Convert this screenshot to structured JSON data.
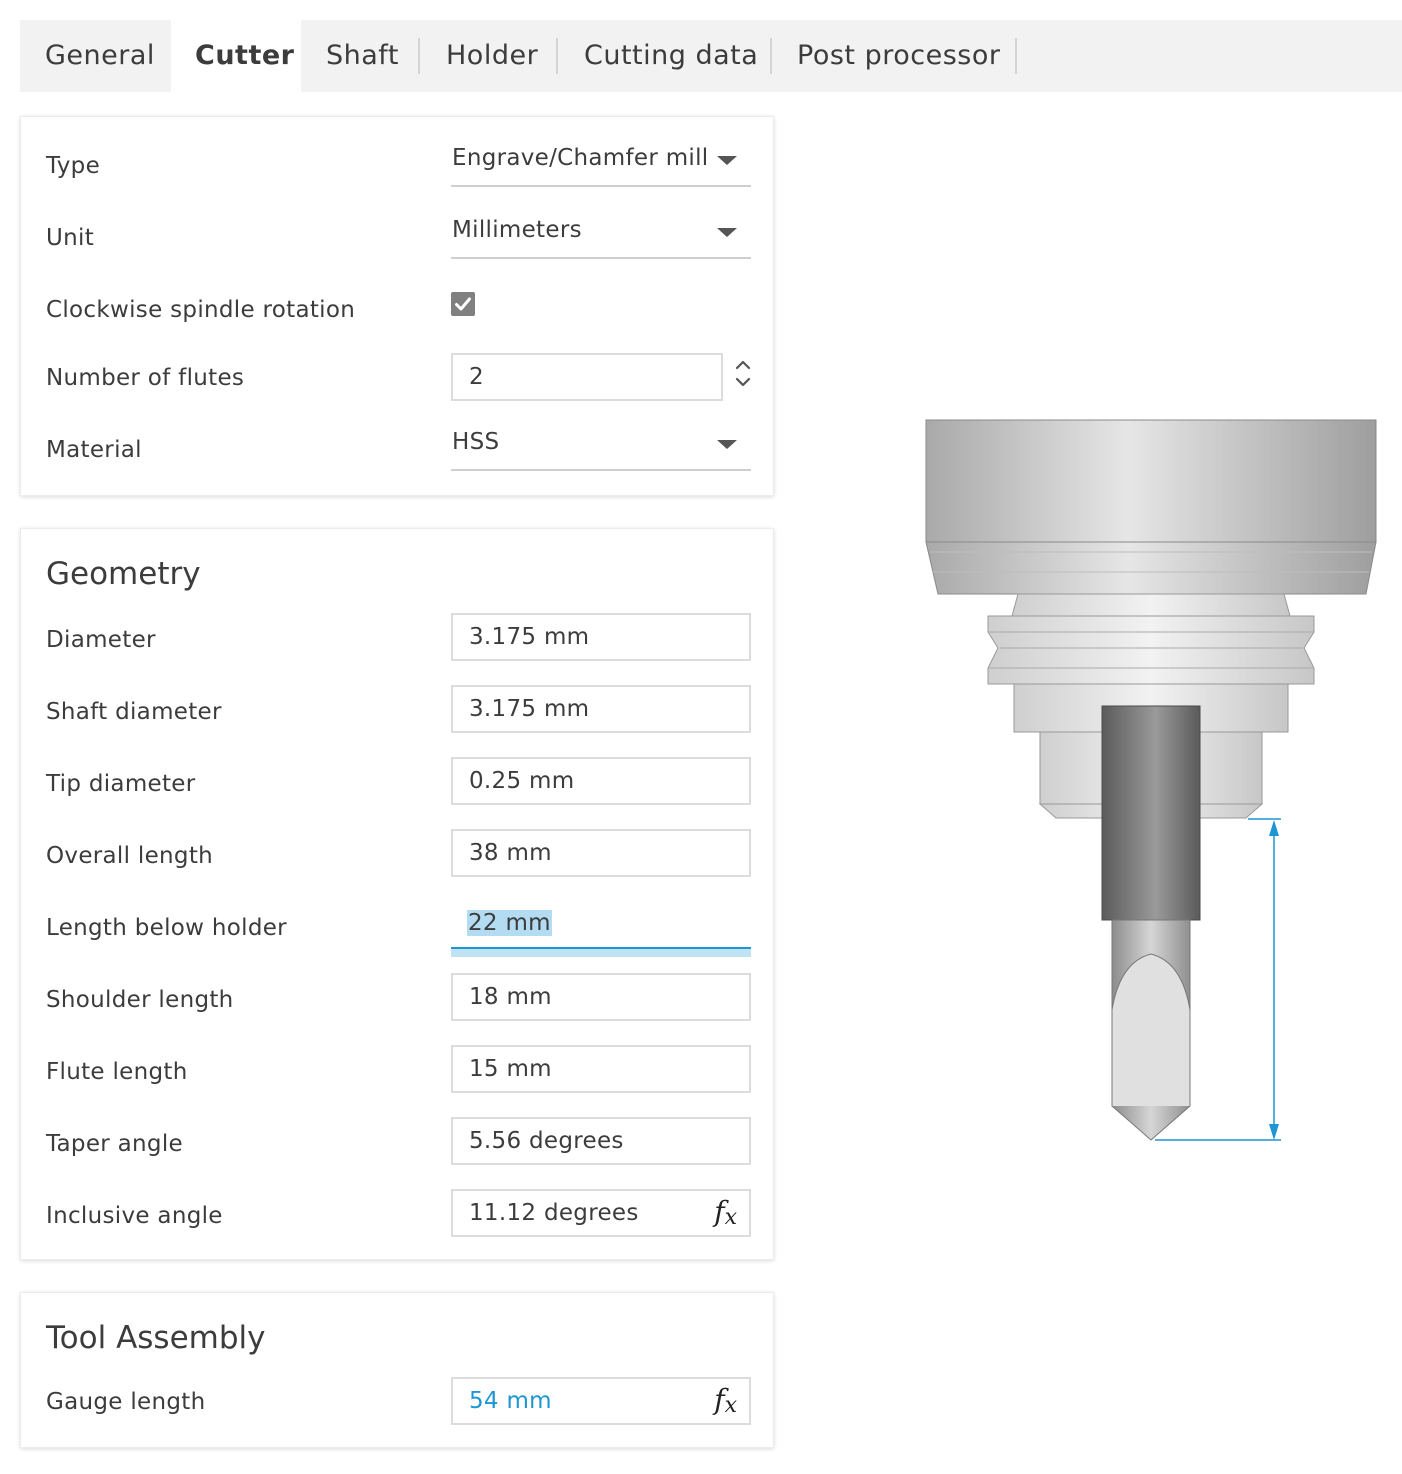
{
  "tabs": [
    {
      "label": "General",
      "active": false
    },
    {
      "label": "Cutter",
      "active": true
    },
    {
      "label": "Shaft",
      "active": false
    },
    {
      "label": "Holder",
      "active": false
    },
    {
      "label": "Cutting data",
      "active": false
    },
    {
      "label": "Post processor",
      "active": false
    }
  ],
  "cutter": {
    "type_label": "Type",
    "type_value": "Engrave/Chamfer mill",
    "unit_label": "Unit",
    "unit_value": "Millimeters",
    "clockwise_label": "Clockwise spindle rotation",
    "clockwise_checked": true,
    "flutes_label": "Number of flutes",
    "flutes_value": "2",
    "material_label": "Material",
    "material_value": "HSS"
  },
  "geometry": {
    "title": "Geometry",
    "diameter_label": "Diameter",
    "diameter_value": "3.175 mm",
    "shaft_diameter_label": "Shaft diameter",
    "shaft_diameter_value": "3.175 mm",
    "tip_diameter_label": "Tip diameter",
    "tip_diameter_value": "0.25 mm",
    "overall_length_label": "Overall length",
    "overall_length_value": "38 mm",
    "length_below_holder_label": "Length below holder",
    "length_below_holder_value": "22 mm",
    "shoulder_length_label": "Shoulder length",
    "shoulder_length_value": "18 mm",
    "flute_length_label": "Flute length",
    "flute_length_value": "15 mm",
    "taper_angle_label": "Taper angle",
    "taper_angle_value": "5.56 degrees",
    "inclusive_angle_label": "Inclusive angle",
    "inclusive_angle_value": "11.12 degrees"
  },
  "tool_assembly": {
    "title": "Tool Assembly",
    "gauge_length_label": "Gauge length",
    "gauge_length_value": "54 mm"
  },
  "icons": {
    "dropdown": "caret-down-icon",
    "checkbox": "checkmark-icon",
    "stepper": "chevron-up-down-icon",
    "formula": "fx-icon"
  },
  "colors": {
    "accent": "#1f96d4",
    "dimension_line": "#1f96d4",
    "checkbox_fill": "#808080",
    "tab_bar": "#f2f2f2"
  }
}
